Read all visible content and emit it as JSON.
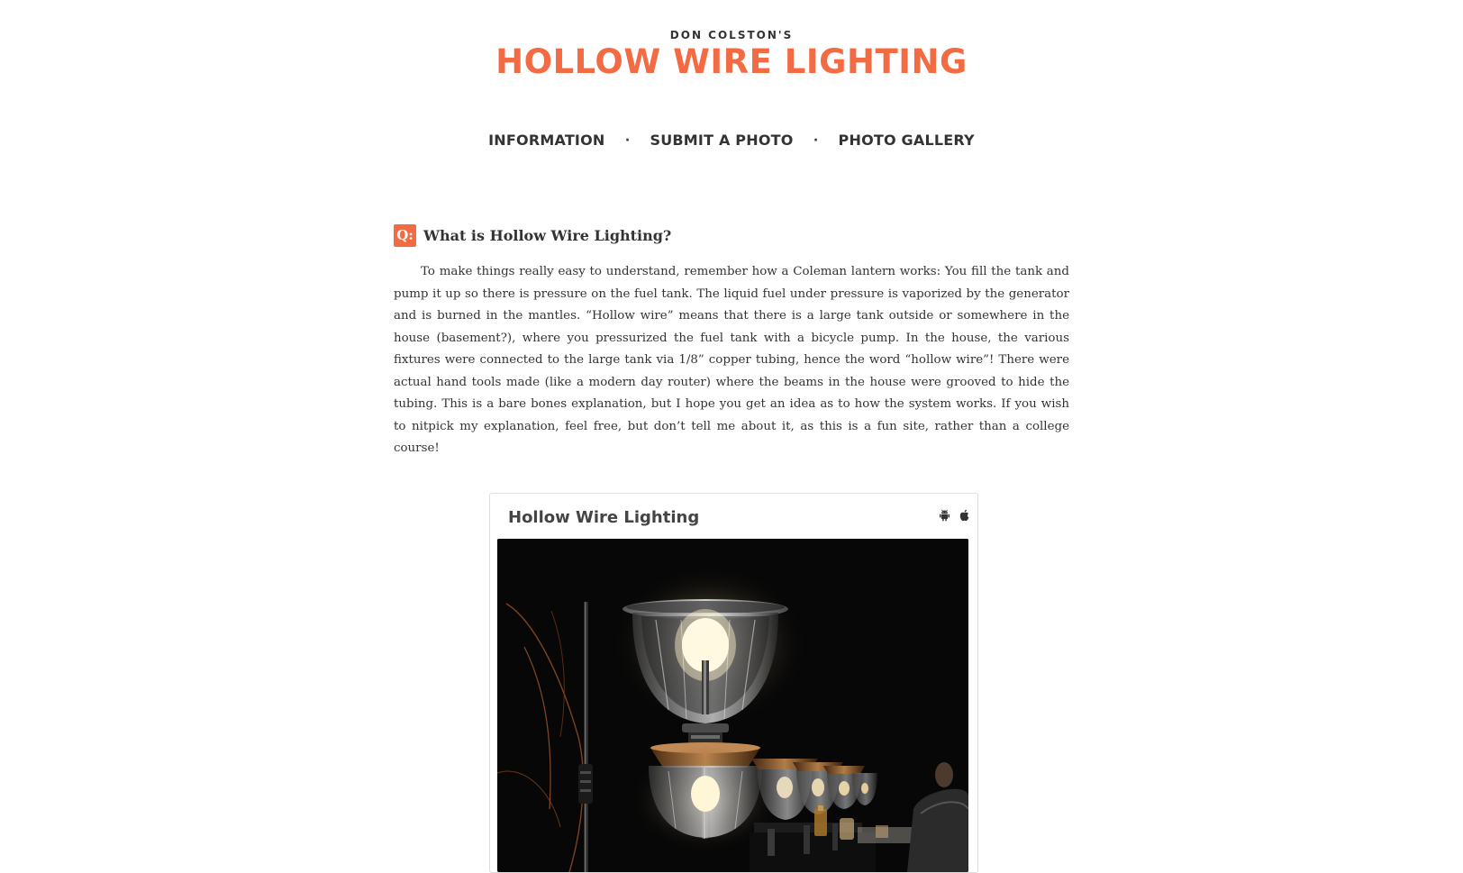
{
  "header": {
    "kicker": "DON COLSTON'S",
    "title": "HOLLOW WIRE LIGHTING"
  },
  "nav": {
    "items": [
      {
        "label": "INFORMATION"
      },
      {
        "label": "SUBMIT A PHOTO"
      },
      {
        "label": "PHOTO GALLERY"
      }
    ],
    "separator": "·"
  },
  "faq": {
    "badge": "Q:",
    "question": "What is Hollow Wire Lighting?",
    "answer": "To make things really easy to understand, remember how a Coleman lantern works: You fill the tank and pump it up so there is pressure on the fuel tank. The liquid fuel under pressure is vaporized by the generator and is burned in the mantles. “Hollow wire” means that there is a large tank outside or somewhere in the house (basement?), where you pressurized the fuel tank with a bicycle pump. In the house, the various fixtures were connected to the large tank via 1/8” copper tubing, hence the word “hollow wire”! There were actual hand tools made (like a modern day router) where the beams in the house were grooved to hide the tubing. This is a bare bones explanation, but I hope you get an idea as to how the system works. If you wish to nitpick my explanation, feel free, but don’t tell me about it, as this is a fun site, rather than a college course!"
  },
  "widget": {
    "title": "Hollow Wire Lighting",
    "icons": [
      "android-icon",
      "apple-icon"
    ]
  },
  "colors": {
    "accent": "#f26b43",
    "text": "#333333"
  }
}
